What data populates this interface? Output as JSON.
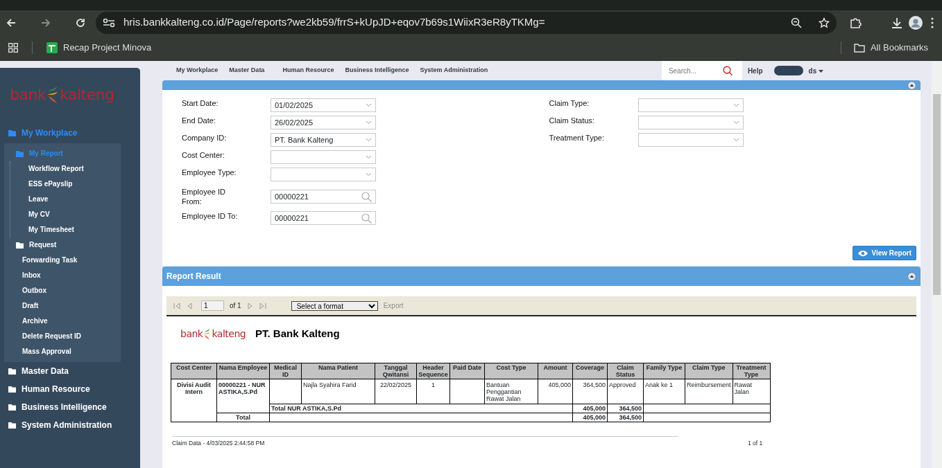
{
  "browser": {
    "url": "hris.bankkalteng.co.id/Page/reports?we2kb59/frrS+kUpJD+eqov7b69s1WiixR3eR8yTKMg=",
    "bookmarks": [
      "Recap Project Minova"
    ],
    "all_bookmarks": "All Bookmarks"
  },
  "sidebar": {
    "logo": {
      "left": "bank",
      "right": "kalteng"
    },
    "items": [
      {
        "label": "My Workplace",
        "kind": "folder",
        "selected": true,
        "children": [
          {
            "label": "My Report",
            "kind": "folder",
            "selected": true,
            "children": [
              {
                "label": "Workflow Report",
                "kind": "link",
                "selected": false
              },
              {
                "label": "ESS ePayslip",
                "kind": "link",
                "selected": false
              },
              {
                "label": "Leave",
                "kind": "link",
                "selected": false
              },
              {
                "label": "My CV",
                "kind": "link",
                "selected": false
              },
              {
                "label": "My Timesheet",
                "kind": "link",
                "selected": false
              }
            ]
          },
          {
            "label": "Request",
            "kind": "folder",
            "selected": false
          },
          {
            "label": "Forwarding Task",
            "kind": "link",
            "selected": false
          },
          {
            "label": "Inbox",
            "kind": "link",
            "selected": false
          },
          {
            "label": "Outbox",
            "kind": "link",
            "selected": false
          },
          {
            "label": "Draft",
            "kind": "link",
            "selected": false
          },
          {
            "label": "Archive",
            "kind": "link",
            "selected": false
          },
          {
            "label": "Delete Request ID",
            "kind": "link",
            "selected": false
          },
          {
            "label": "Mass Approval",
            "kind": "link",
            "selected": false
          }
        ]
      },
      {
        "label": "Master Data",
        "kind": "folder",
        "selected": false
      },
      {
        "label": "Human Resource",
        "kind": "folder",
        "selected": false
      },
      {
        "label": "Business Intelligence",
        "kind": "folder",
        "selected": false
      },
      {
        "label": "System Administration",
        "kind": "folder",
        "selected": false
      }
    ]
  },
  "top_nav": {
    "menu": [
      "My Workplace",
      "Master Data",
      "Human Resource",
      "Business Intelligence",
      "System Administration"
    ],
    "search": {
      "placeholder": "Search..."
    },
    "help": "Help",
    "user": "ds"
  },
  "report_parameter": {
    "left_fields": [
      {
        "label": "Start Date:",
        "value": "01/02/2025",
        "kind": "dropdown"
      },
      {
        "label": "End Date:",
        "value": "26/02/2025",
        "kind": "dropdown"
      },
      {
        "label": "Company ID:",
        "value": "PT. Bank Kalteng",
        "kind": "dropdown"
      },
      {
        "label": "Cost Center:",
        "kind": "dropdown"
      },
      {
        "label": "Employee Type:",
        "kind": "dropdown"
      },
      {
        "label": "Employee ID From:",
        "value": "00000221",
        "kind": "lookup"
      },
      {
        "label": "Employee ID To:",
        "value": "00000221",
        "kind": "lookup"
      }
    ],
    "right_fields": [
      {
        "label": "Claim Type:",
        "kind": "dropdown"
      },
      {
        "label": "Claim Status:",
        "kind": "dropdown"
      },
      {
        "label": "Treatment Type:",
        "kind": "dropdown"
      }
    ],
    "view_button": "View Report"
  },
  "report_result": {
    "title": "Report Result",
    "toolbar": {
      "page": "1",
      "of": "of 1",
      "format": "Select a format",
      "export": "Export",
      "export_disabled": true
    },
    "report": {
      "logo": {
        "left": "bank",
        "right": "kalteng"
      },
      "title": "PT. Bank Kalteng",
      "columns": [
        "Cost Center",
        "Nama Employee",
        "Medical ID",
        "Nama Patient",
        "Tanggal Qwitansi",
        "Header Sequence",
        "Paid Date",
        "Cost Type",
        "Amount",
        "Coverage",
        "Claim Status",
        "Family Type",
        "Claim Type",
        "Treatment Type"
      ],
      "group": {
        "cost_center": "Divisi Audit Intern",
        "employee": "00000221 - NUR ASTIKA,S.Pd",
        "rows": [
          [
            "",
            "Najla Syahira Farid",
            "22/02/2025",
            "1",
            "",
            "Bantuan Penggantian Rawat Jalan",
            "405,000",
            "364,500",
            "Approved",
            "Anak ke 1",
            "Reimbursement",
            "Rawat Jalan"
          ]
        ],
        "subtotal": {
          "label": "Total NUR ASTIKA,S.Pd",
          "amount": "405,000",
          "coverage": "364,500"
        }
      },
      "total": {
        "label": "Total",
        "amount": "405,000",
        "coverage": "364,500"
      },
      "footer": {
        "left": "Claim Data - 4/03/2025 2:44:58 PM",
        "right": "1 of 1"
      }
    }
  }
}
